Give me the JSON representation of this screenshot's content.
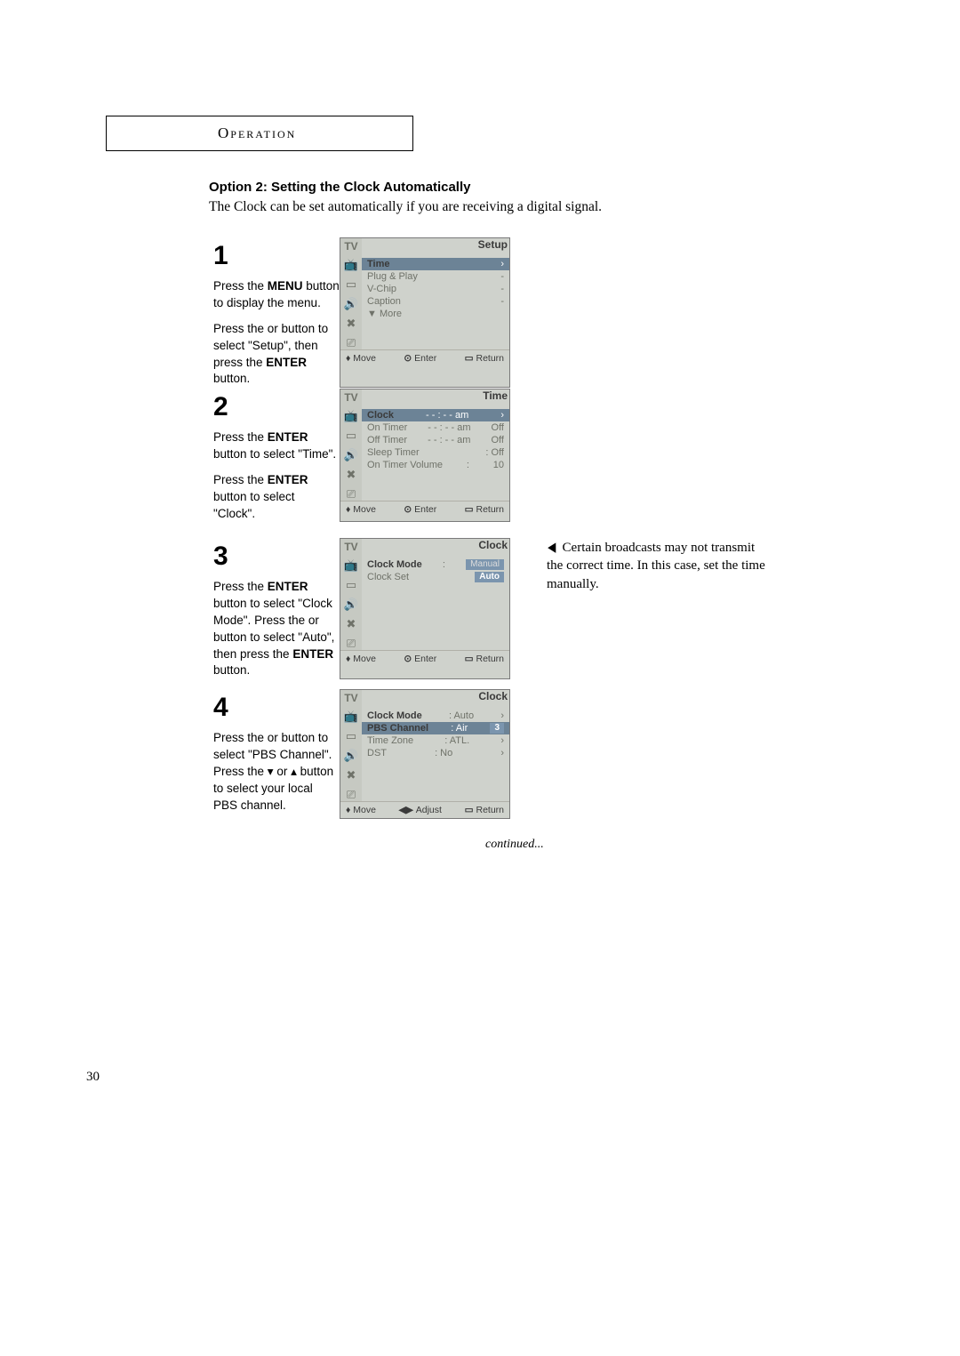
{
  "section_header": "Operation",
  "subheading": "Option 2: Setting the Clock Automatically",
  "intro_text": "The Clock can be set automatically if you are receiving a digital signal.",
  "steps": {
    "s1": {
      "num": "1",
      "line1a": "Press the ",
      "line1b": "MENU",
      "line1c": " button to display the menu.",
      "line2a": "Press the ",
      "line2b": " or ",
      "line2c": " button to select \"Setup\", then press the ",
      "line2d": "ENTER",
      "line2e": " button."
    },
    "s2": {
      "num": "2",
      "line1a": "Press the ",
      "line1b": "ENTER",
      "line1c": " button to select \"Time\".",
      "line2a": "Press the ",
      "line2b": "ENTER",
      "line2c": " button to select \"Clock\"."
    },
    "s3": {
      "num": "3",
      "line1a": "Press the ",
      "line1b": "ENTER",
      "line1c": " button to select \"Clock Mode\".",
      "line2a": "Press the ",
      "line2b": " or ",
      "line2c": " button to select \"Auto\", then press the ",
      "line2d": "ENTER",
      "line2e": " button."
    },
    "s4": {
      "num": "4",
      "line1a": "Press the ",
      "line1b": " or ",
      "line1c": " button to select \"PBS Channel\".",
      "line2a": "Press the ",
      "line2up": "▾",
      "line2b": " or ",
      "line2dn": "▴",
      "line2c": " button to select your local PBS channel."
    }
  },
  "osd1": {
    "tv": "TV",
    "header_right": "Setup",
    "items": [
      "Time",
      "Plug & Play",
      "V-Chip",
      "Caption",
      "▼ More"
    ],
    "footer": {
      "move": "Move",
      "enter": "Enter",
      "return": "Return"
    }
  },
  "osd2": {
    "tv": "TV",
    "header_right": "Time",
    "rows": [
      {
        "l": "Clock",
        "m": "- - : - - am",
        "r": ""
      },
      {
        "l": "On Timer",
        "m": "- - : - - am",
        "r": "Off"
      },
      {
        "l": "Off Timer",
        "m": "- - : - - am",
        "r": "Off"
      },
      {
        "l": "Sleep Timer",
        "m": ": Off",
        "r": ""
      },
      {
        "l": "On Timer Volume",
        "m": ":",
        "r": "10"
      }
    ],
    "footer": {
      "move": "Move",
      "enter": "Enter",
      "return": "Return"
    }
  },
  "osd3": {
    "tv": "TV",
    "header_right": "Clock",
    "rows": [
      {
        "l": "Clock Mode",
        "m": ":",
        "r_hl": "Manual"
      },
      {
        "l": "Clock Set",
        "m": "",
        "r_hl": "Auto"
      }
    ],
    "footer": {
      "move": "Move",
      "enter": "Enter",
      "return": "Return"
    }
  },
  "osd4": {
    "tv": "TV",
    "header_right": "Clock",
    "rows": [
      {
        "l": "Clock Mode",
        "m": ": Auto",
        "r": ""
      },
      {
        "l": "PBS Channel",
        "m": ": Air",
        "r_hl": "3",
        "hl": true
      },
      {
        "l": "Time Zone",
        "m": ": ATL.",
        "r": ""
      },
      {
        "l": "DST",
        "m": ": No",
        "r": ""
      }
    ],
    "footer": {
      "move": "Move",
      "adjust": "Adjust",
      "return": "Return"
    }
  },
  "side_note": "Certain broadcasts may not transmit the correct time. In this case, set the time manually.",
  "continued": "continued...",
  "page_number": "30"
}
